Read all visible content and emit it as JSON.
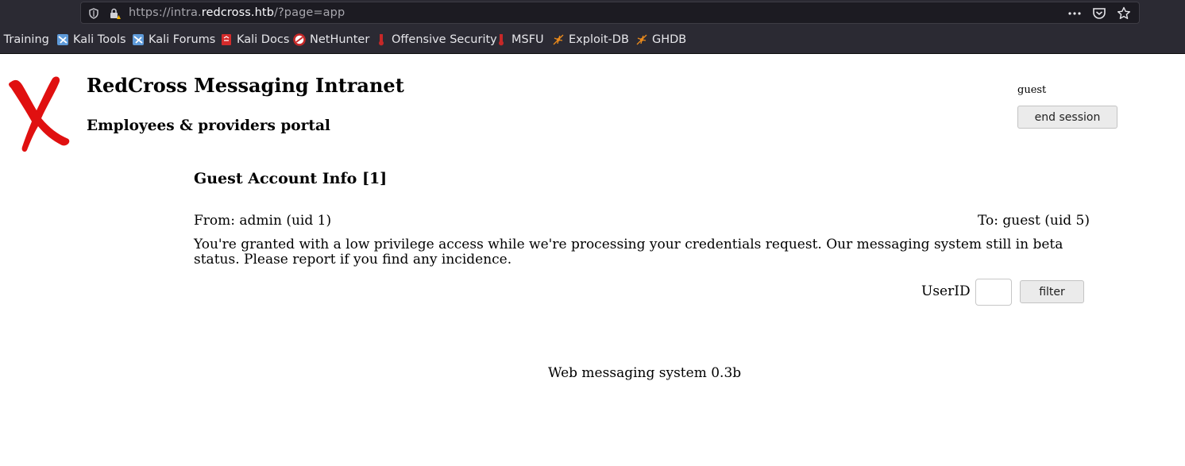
{
  "browser": {
    "url_prefix": "https://intra.",
    "url_host": "redcross.htb",
    "url_path": "/?page=app",
    "bookmarks": [
      {
        "label": "i Training",
        "icon": "kali-training-icon"
      },
      {
        "label": "Kali Tools",
        "icon": "kali-dragon-icon"
      },
      {
        "label": "Kali Forums",
        "icon": "kali-dragon-icon"
      },
      {
        "label": "Kali Docs",
        "icon": "kali-docs-icon"
      },
      {
        "label": "NetHunter",
        "icon": "nethunter-icon"
      },
      {
        "label": "Offensive Security",
        "icon": "offsec-icon"
      },
      {
        "label": "MSFU",
        "icon": "offsec-icon"
      },
      {
        "label": "Exploit-DB",
        "icon": "exploitdb-spider-icon"
      },
      {
        "label": "GHDB",
        "icon": "exploitdb-spider-icon"
      }
    ]
  },
  "header": {
    "title": "RedCross Messaging Intranet",
    "subtitle": "Employees & providers portal",
    "user": "guest",
    "end_session_label": "end session"
  },
  "message": {
    "title": "Guest Account Info [1]",
    "from": "From: admin (uid 1)",
    "to": "To: guest (uid 5)",
    "body": "You're granted with a low privilege access while we're processing your credentials request. Our messaging system still in beta status. Please report if you find any incidence."
  },
  "filter": {
    "label": "UserID",
    "value": "",
    "button_label": "filter"
  },
  "footer": {
    "text": "Web messaging system 0.3b"
  },
  "colors": {
    "chrome_bg": "#2b2a33",
    "urlbar_bg": "#1c1b22",
    "logo_red": "#e01010"
  }
}
